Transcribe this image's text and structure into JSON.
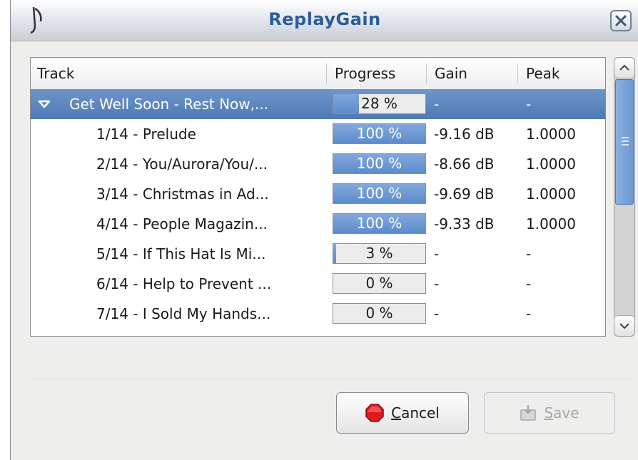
{
  "window": {
    "title": "ReplayGain",
    "app_icon": "music-note-icon",
    "close_icon": "close-icon"
  },
  "table": {
    "columns": [
      "Track",
      "Progress",
      "Gain",
      "Peak"
    ],
    "album": {
      "label": "Get Well Soon - Rest Now,...",
      "progress": 28,
      "progress_label": "28 %",
      "gain": "-",
      "peak": "-"
    },
    "rows": [
      {
        "track": "1/14 - Prelude",
        "progress": 100,
        "progress_label": "100 %",
        "gain": "-9.16 dB",
        "peak": "1.0000"
      },
      {
        "track": "2/14 - You/Aurora/You/...",
        "progress": 100,
        "progress_label": "100 %",
        "gain": "-8.66 dB",
        "peak": "1.0000"
      },
      {
        "track": "3/14 - Christmas in Ad...",
        "progress": 100,
        "progress_label": "100 %",
        "gain": "-9.69 dB",
        "peak": "1.0000"
      },
      {
        "track": "4/14 - People Magazin...",
        "progress": 100,
        "progress_label": "100 %",
        "gain": "-9.33 dB",
        "peak": "1.0000"
      },
      {
        "track": "5/14 - If This Hat Is Mi...",
        "progress": 3,
        "progress_label": "3 %",
        "gain": "-",
        "peak": "-"
      },
      {
        "track": "6/14 - Help to Prevent ...",
        "progress": 0,
        "progress_label": "0 %",
        "gain": "-",
        "peak": "-"
      },
      {
        "track": "7/14 - I Sold My Hands...",
        "progress": 0,
        "progress_label": "0 %",
        "gain": "-",
        "peak": "-"
      }
    ]
  },
  "buttons": {
    "cancel_mnemonic": "C",
    "cancel_rest": "ancel",
    "cancel_icon": "stop-icon",
    "save_mnemonic": "S",
    "save_rest": "ave",
    "save_icon": "save-icon"
  },
  "colors": {
    "selection": "#5b84bd",
    "progress_fill": "#6f98d2",
    "title": "#2a5d9a",
    "stop": "#e0191b"
  }
}
